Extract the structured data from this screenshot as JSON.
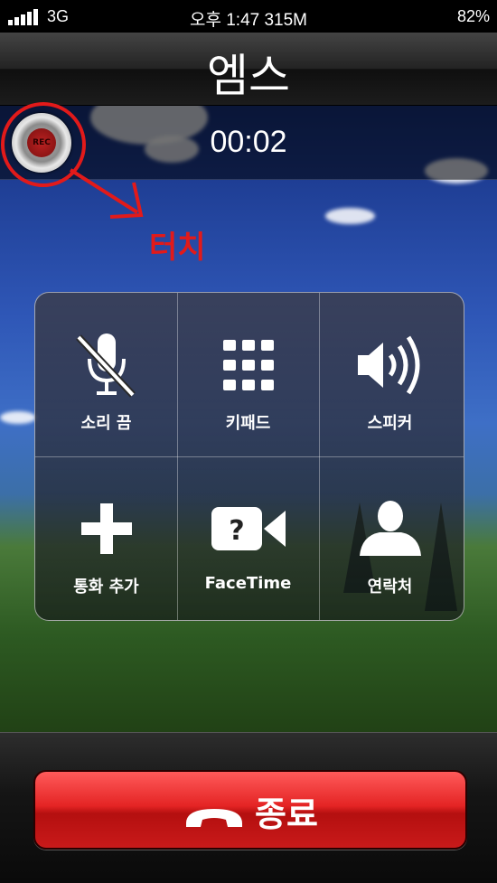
{
  "status": {
    "network": "3G",
    "time": "오후 1:47 315M",
    "battery": "82%"
  },
  "call": {
    "name": "엠스",
    "duration": "00:02"
  },
  "rec": {
    "label": "REC"
  },
  "annotation": {
    "text": "터치",
    "color": "#e21a1a"
  },
  "buttons": [
    {
      "label": "소리 끔",
      "icon": "mute-icon"
    },
    {
      "label": "키패드",
      "icon": "keypad-icon"
    },
    {
      "label": "스피커",
      "icon": "speaker-icon"
    },
    {
      "label": "통화 추가",
      "icon": "add-call-icon"
    },
    {
      "label": "FaceTime",
      "icon": "facetime-icon"
    },
    {
      "label": "연락처",
      "icon": "contacts-icon"
    }
  ],
  "end_call": {
    "label": "종료",
    "icon": "end-call-icon",
    "color": "#e42424"
  }
}
